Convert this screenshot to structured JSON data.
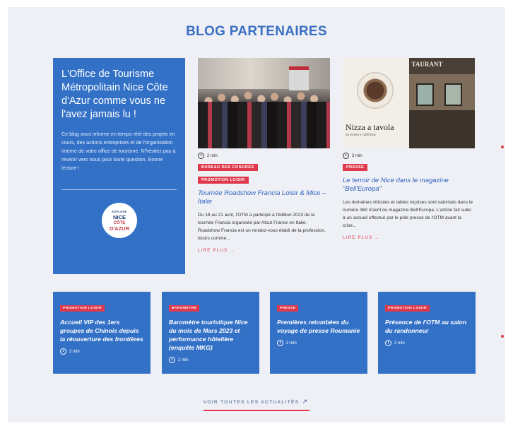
{
  "section_title": "BLOG PARTENAIRES",
  "intro": {
    "heading": "L'Office de Tourisme Métropolitain Nice Côte d'Azur comme vous ne l'avez jamais lu !",
    "text": "Ce blog vous informe en temps réel des projets en cours, des actions entreprises et de l'organisation interne de votre office de tourisme. N'hésitez pas à revenir vers nous pour toute question. Bonne lecture !",
    "logo": {
      "line1": "EXPLORE",
      "line2": "NICE",
      "line3": "CÔTE",
      "line4": "D'AZUR"
    }
  },
  "articles": [
    {
      "read_time": "2 min",
      "tags": [
        "BUREAU DES CONGRÈS",
        "PROMOTION LOISIR"
      ],
      "title": "Tournée Roadshow Francia Loisir & Mice – Italie",
      "excerpt": "Du 18 au 21 avril, l'OTM a participé à l'édition 2023 de la tournée Francia organisée par Atout France en Italie. Roadshow Francia est un rendez-vous établi de la profession, loisirs comme...",
      "read_more": "LIRE PLUS →"
    },
    {
      "read_time": "3 min",
      "tags": [
        "PRESSE"
      ],
      "title": "Le terroir de Nice dans le magazine \"Bell'Europa\"",
      "excerpt": "Les domaines viticoles et tables niçoises sont valorisés dans le numéro 360 d'avril du magazine Bell'Europa. L'article fait suite à un accueil effectué par le pôle presse de l'OTM avant la crise...",
      "read_more": "LIRE PLUS →",
      "photo_text": {
        "mag_title": "Nizza a tavola",
        "mag_sub": "tra ricette e caffè Doc",
        "sign": "TAURANT"
      }
    }
  ],
  "cards": [
    {
      "tag": "PROMOTION LOISIR",
      "title": "Accueil VIP des 1ers groupes de Chinois depuis la réouverture des frontières",
      "read_time": "2 min"
    },
    {
      "tag": "BAROMÈTRE",
      "title": "Baromètre touristique Nice du mois de Mars 2023 et performance hôtelière (enquête MKG)",
      "read_time": "2 min"
    },
    {
      "tag": "PRESSE",
      "title": "Premières retombées du voyage de presse Roumanie",
      "read_time": "2 min"
    },
    {
      "tag": "PROMOTION LOISIR",
      "title": "Présence de l'OTM au salon du randonneur",
      "read_time": "2 min"
    }
  ],
  "see_all": "VOIR TOUTES LES ACTUALITÉS",
  "colors": {
    "blue": "#3371c7",
    "title_blue": "#3a6fc4",
    "red": "#e0394b",
    "bg": "#eef0f5"
  }
}
